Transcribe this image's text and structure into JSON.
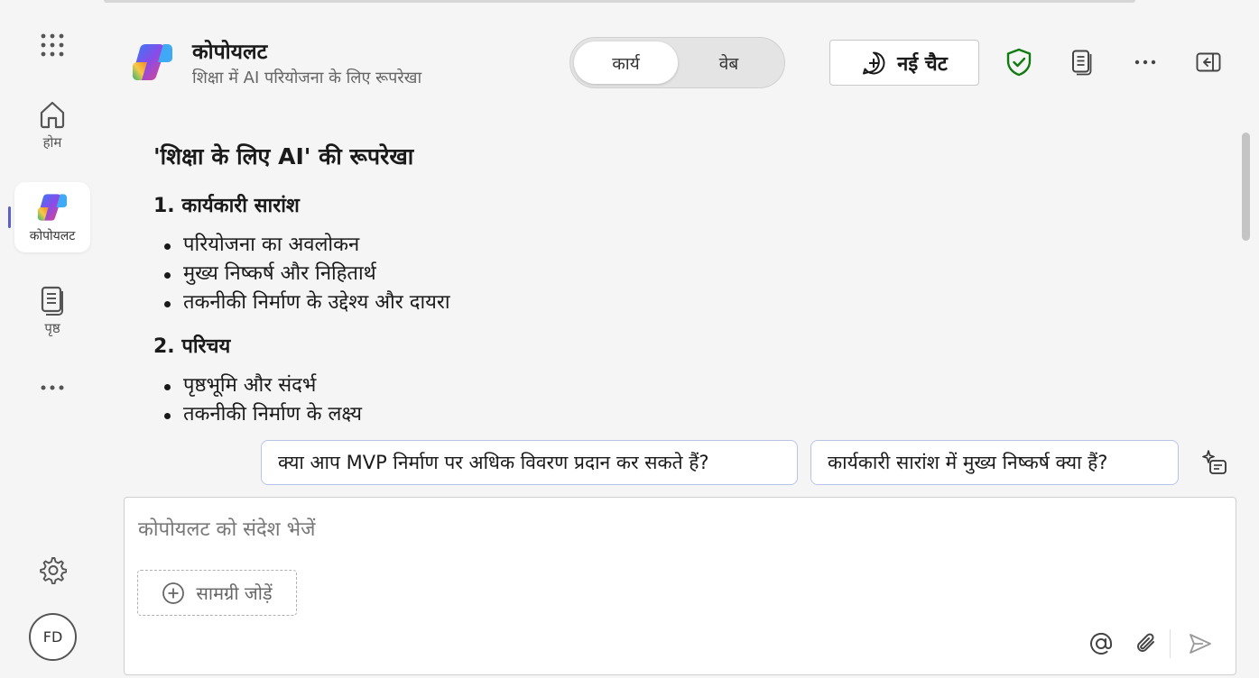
{
  "rail": {
    "home_label": "होम",
    "copilot_label": "कोपोयलट",
    "pages_label": "पृष्ठ",
    "avatar_initials": "FD"
  },
  "header": {
    "title": "कोपोयलट",
    "subtitle": "शिक्षा में AI परियोजना के लिए रूपरेखा",
    "mode_work": "कार्य",
    "mode_web": "वेब",
    "new_chat": "नई चैट",
    "shield_color": "#107c10"
  },
  "response": {
    "heading": "'शिक्षा के लिए AI' की रूपरेखा",
    "sections": [
      {
        "title": "1. कार्यकारी सारांश",
        "items": [
          "परियोजना का अवलोकन",
          "मुख्य निष्कर्ष और निहितार्थ",
          "तकनीकी निर्माण के उद्देश्य और दायरा"
        ]
      },
      {
        "title": "2. परिचय",
        "items": [
          "पृष्ठभूमि और संदर्भ",
          "तकनीकी निर्माण के लक्ष्य"
        ]
      }
    ]
  },
  "suggestions": [
    "क्या आप MVP निर्माण पर अधिक विवरण प्रदान कर सकते हैं?",
    "कार्यकारी सारांश में मुख्य निष्कर्ष क्या हैं?"
  ],
  "composer": {
    "placeholder": "कोपोयलट को संदेश भेजें",
    "add_content": "सामग्री जोड़ें"
  }
}
